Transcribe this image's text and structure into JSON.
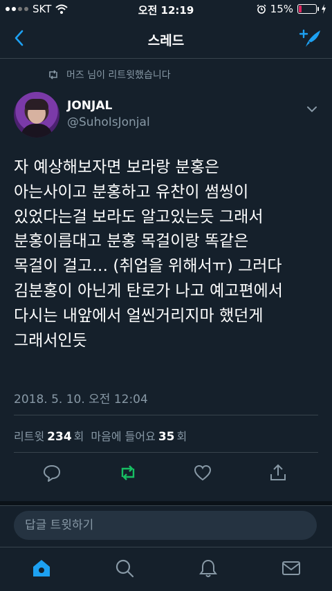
{
  "status_bar": {
    "carrier": "SKT",
    "time": "오전 12:19",
    "battery_percent": "15%",
    "battery_level": 0.15,
    "signal_bars": 2,
    "icons": [
      "wifi-icon",
      "alarm-icon",
      "battery-icon",
      "charging-icon"
    ]
  },
  "nav": {
    "title": "스레드",
    "back_icon": "chevron-left-icon",
    "compose_icon": "compose-feather-icon"
  },
  "tweet": {
    "retweeted_by": "머즈 님이 리트윗했습니다",
    "display_name": "JONJAL",
    "handle": "@SuhoIsJonjal",
    "text": "자 예상해보자면 보라랑 분홍은\n아는사이고 분홍하고 유찬이 썸씽이\n있었다는걸 보라도 알고있는듯 그래서\n분홍이름대고 분홍 목걸이랑 똑같은\n목걸이 걸고… (취업을 위해서ㅠ) 그러다\n김분홍이 아닌게 탄로가 나고 예고편에서\n다시는 내앞에서 얼씬거리지마 했던게\n그래서인듯",
    "timestamp": "2018. 5. 10. 오전 12:04",
    "stats": {
      "retweet_label": "리트윗",
      "retweet_count": "234",
      "retweet_unit": "회",
      "like_label": "마음에 들어요",
      "like_count": "35",
      "like_unit": "회"
    }
  },
  "reply": {
    "placeholder": "답글 트윗하기"
  },
  "tabbar": {
    "items": [
      "home-icon",
      "search-icon",
      "notifications-icon",
      "messages-icon"
    ],
    "active": "home-icon"
  },
  "colors": {
    "background": "#15202b",
    "accent": "#1da1f2",
    "retweet_green": "#17bf63",
    "secondary_text": "#8899a6",
    "battery_low": "#e0245e"
  }
}
